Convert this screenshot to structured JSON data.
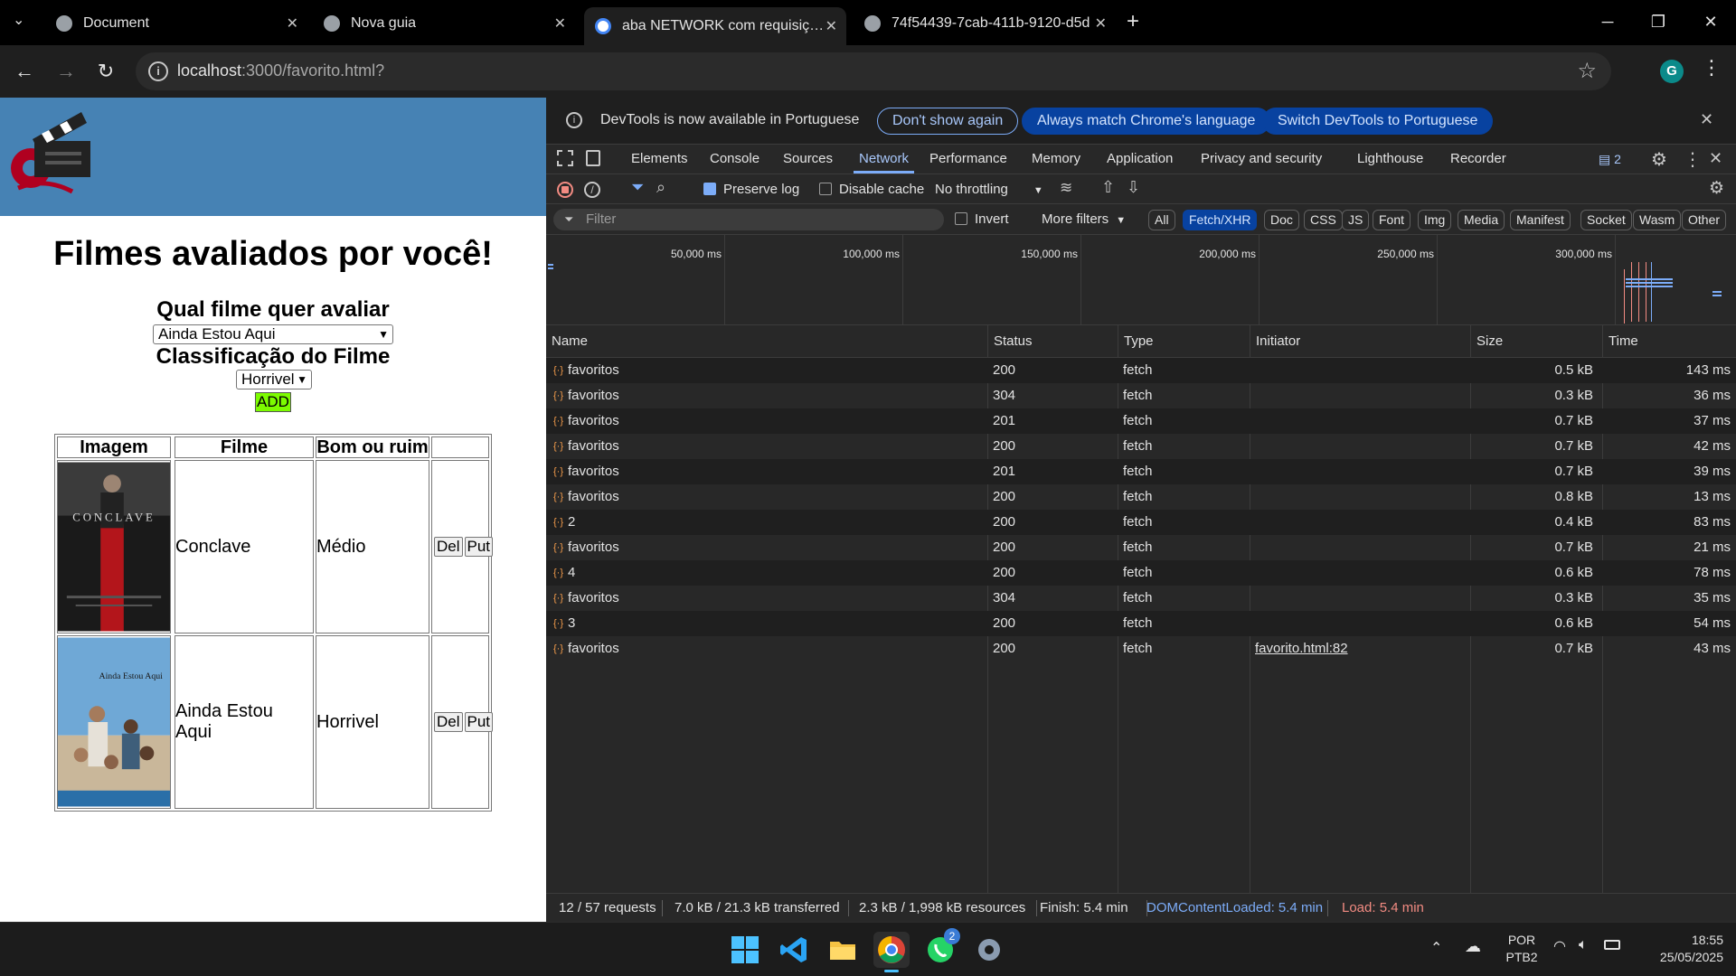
{
  "browser": {
    "tabs": [
      {
        "title": "Document",
        "fav_color": "#9aa0a6"
      },
      {
        "title": "Nova guia",
        "fav_color": "#9aa0a6"
      },
      {
        "title": "aba NETWORK com requisições",
        "fav_color": "#4285f4"
      },
      {
        "title": "74f54439-7cab-411b-9120-d5d",
        "fav_color": "#9aa0a6"
      }
    ],
    "new_tab": "+",
    "url_host": "localhost",
    "url_path": ":3000/favorito.html?",
    "profile_initial": "G"
  },
  "page": {
    "title": "Filmes avaliados por você!",
    "movie_label": "Qual filme quer avaliar",
    "movie_selected": "Ainda Estou Aqui",
    "rating_label": "Classificação do Filme",
    "rating_selected": "Horrivel",
    "add_label": "ADD",
    "table": {
      "headers": [
        "Imagem",
        "Filme",
        "Bom ou ruim"
      ],
      "rows": [
        {
          "poster_text": "CONCLAVE",
          "film": "Conclave",
          "rating": "Médio",
          "del": "Del",
          "put": "Put"
        },
        {
          "poster_text": "Ainda Estou Aqui",
          "film": "Ainda Estou Aqui",
          "rating": "Horrivel",
          "del": "Del",
          "put": "Put"
        }
      ]
    }
  },
  "devtools": {
    "infobar": {
      "message": "DevTools is now available in Portuguese",
      "dont_show": "Don't show again",
      "always_match": "Always match Chrome's language",
      "switch": "Switch DevTools to Portuguese"
    },
    "tabs": [
      "Elements",
      "Console",
      "Sources",
      "Network",
      "Performance",
      "Memory",
      "Application",
      "Privacy and security",
      "Lighthouse",
      "Recorder"
    ],
    "issues_count": "2",
    "toolbar": {
      "preserve_log": "Preserve log",
      "disable_cache": "Disable cache",
      "throttling": "No throttling"
    },
    "filter": {
      "placeholder": "Filter",
      "invert": "Invert",
      "more_filters": "More filters",
      "chips": [
        "All",
        "Fetch/XHR",
        "Doc",
        "CSS",
        "JS",
        "Font",
        "Img",
        "Media",
        "Manifest",
        "Socket",
        "Wasm",
        "Other"
      ]
    },
    "timeline_labels": [
      "50,000 ms",
      "100,000 ms",
      "150,000 ms",
      "200,000 ms",
      "250,000 ms",
      "300,000 ms"
    ],
    "columns": [
      "Name",
      "Status",
      "Type",
      "Initiator",
      "Size",
      "Time"
    ],
    "requests": [
      {
        "name": "favoritos",
        "status": "200",
        "type": "fetch",
        "initiator": "",
        "size": "0.5 kB",
        "time": "143 ms"
      },
      {
        "name": "favoritos",
        "status": "304",
        "type": "fetch",
        "initiator": "",
        "size": "0.3 kB",
        "time": "36 ms"
      },
      {
        "name": "favoritos",
        "status": "201",
        "type": "fetch",
        "initiator": "",
        "size": "0.7 kB",
        "time": "37 ms"
      },
      {
        "name": "favoritos",
        "status": "200",
        "type": "fetch",
        "initiator": "",
        "size": "0.7 kB",
        "time": "42 ms"
      },
      {
        "name": "favoritos",
        "status": "201",
        "type": "fetch",
        "initiator": "",
        "size": "0.7 kB",
        "time": "39 ms"
      },
      {
        "name": "favoritos",
        "status": "200",
        "type": "fetch",
        "initiator": "",
        "size": "0.8 kB",
        "time": "13 ms"
      },
      {
        "name": "2",
        "status": "200",
        "type": "fetch",
        "initiator": "",
        "size": "0.4 kB",
        "time": "83 ms"
      },
      {
        "name": "favoritos",
        "status": "200",
        "type": "fetch",
        "initiator": "",
        "size": "0.7 kB",
        "time": "21 ms"
      },
      {
        "name": "4",
        "status": "200",
        "type": "fetch",
        "initiator": "",
        "size": "0.6 kB",
        "time": "78 ms"
      },
      {
        "name": "favoritos",
        "status": "304",
        "type": "fetch",
        "initiator": "",
        "size": "0.3 kB",
        "time": "35 ms"
      },
      {
        "name": "3",
        "status": "200",
        "type": "fetch",
        "initiator": "",
        "size": "0.6 kB",
        "time": "54 ms"
      },
      {
        "name": "favoritos",
        "status": "200",
        "type": "fetch",
        "initiator": "favorito.html:82",
        "size": "0.7 kB",
        "time": "43 ms"
      }
    ],
    "status": {
      "requests": "12 / 57 requests",
      "transferred": "7.0 kB / 21.3 kB transferred",
      "resources": "2.3 kB / 1,998 kB resources",
      "finish": "Finish: 5.4 min",
      "dcl": "DOMContentLoaded: 5.4 min",
      "load": "Load: 5.4 min"
    }
  },
  "taskbar": {
    "whatsapp_badge": "2",
    "lang_line1": "POR",
    "lang_line2": "PTB2",
    "time": "18:55",
    "date": "25/05/2025"
  },
  "colors": {
    "accent": "#7cacf8",
    "banner": "#4682b4",
    "add_button": "#7cfc00",
    "dcl": "#7cacf8",
    "load": "#f28b82"
  }
}
